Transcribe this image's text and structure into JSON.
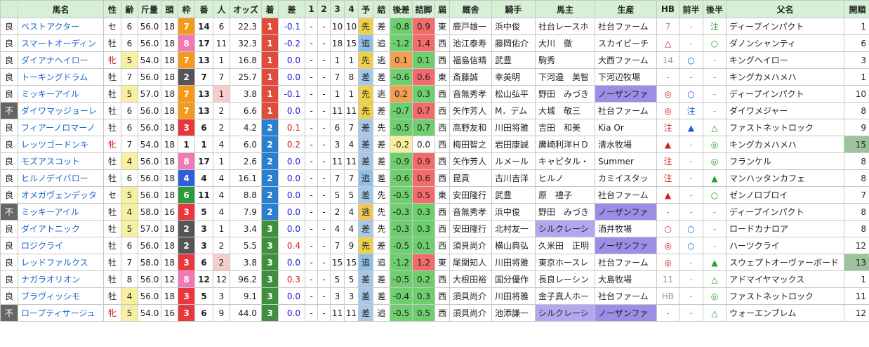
{
  "columns": [
    "馬名",
    "性",
    "齢",
    "斤量",
    "頭",
    "枠",
    "番",
    "人",
    "オッズ",
    "着",
    "差",
    "1",
    "2",
    "3",
    "4",
    "予",
    "結",
    "後差",
    "詰脚",
    "屆",
    "厩舎",
    "騎手",
    "馬主",
    "生産",
    "HB",
    "前半",
    "後半",
    "父名",
    "開順"
  ],
  "colors": {
    "header": "#d6f0d6",
    "frame": {
      "1": "#ffffff",
      "2": "#555555",
      "3": "#e8383d",
      "4": "#2d5fd8",
      "5": "#f2df30",
      "6": "#2a9a3c",
      "7": "#f39a1c",
      "8": "#f07ab4"
    },
    "finish": {
      "1": "#e24a3a",
      "2": "#2a7fd0",
      "3": "#3f8f3f"
    },
    "yoso": {
      "先": "#ecd24a",
      "追": "#8fbfe6",
      "差": "#a8c8e8",
      "逃": "#ecc85a"
    },
    "kekka": {
      "逃": "#ffffff",
      "先": "#ffffff",
      "差": "#ffffff",
      "追": "#ffffff"
    },
    "owner_special": "#b5a6f0",
    "breeder_special": "#9a8ee6"
  },
  "rows": [
    {
      "cond": "良",
      "name": "ベストアクター",
      "sex": "セ",
      "age": "6",
      "weight": "56.0",
      "heads": "18",
      "frame": "7",
      "num": "14",
      "pop": "6",
      "pop_hl": "",
      "odds": "22.3",
      "finish": "1",
      "margin": "-0.1",
      "c1": "-",
      "c2": "-",
      "c3": "10",
      "c4": "10",
      "yoso": "先",
      "kekka": "差",
      "late": "-0.8",
      "late_bg": "#6ecf6e",
      "tsume": "0.9",
      "tsume_bg": "#f36b6b",
      "area": "東",
      "trainer": "鹿戸雄一",
      "jockey": "浜中俊",
      "owner": "社台レースホ",
      "owner_hl": false,
      "breeder": "社台ファーム",
      "breeder_hl": false,
      "hb": "7",
      "hb_color": "#999999",
      "front": "-",
      "front_color": "#999999",
      "back": "注",
      "back_color": "#2aa02a",
      "sire": "ディープインパクト",
      "open": "1",
      "open_bg": ""
    },
    {
      "cond": "良",
      "name": "スマートオーディン",
      "sex": "牡",
      "age": "6",
      "weight": "56.0",
      "heads": "18",
      "frame": "8",
      "num": "17",
      "pop": "11",
      "pop_hl": "",
      "odds": "32.3",
      "finish": "1",
      "margin": "-0.2",
      "c1": "-",
      "c2": "-",
      "c3": "18",
      "c4": "15",
      "yoso": "追",
      "kekka": "追",
      "late": "-1.2",
      "late_bg": "#6ecf6e",
      "tsume": "1.4",
      "tsume_bg": "#f36b6b",
      "area": "西",
      "trainer": "池江泰寿",
      "jockey": "藤岡佑介",
      "owner": "大川　徹",
      "owner_hl": false,
      "breeder": "スカイビーチ",
      "breeder_hl": false,
      "hb": "△",
      "hb_color": "#cc2222",
      "front": "-",
      "front_color": "#999999",
      "back": "○",
      "back_color": "#2aa02a",
      "sire": "ダノンシャンティ",
      "open": "6",
      "open_bg": ""
    },
    {
      "cond": "良",
      "name": "ダイアナヘイロー",
      "sex": "牝",
      "age": "5",
      "weight": "54.0",
      "heads": "18",
      "frame": "7",
      "num": "13",
      "pop": "1",
      "pop_hl": "",
      "odds": "16.8",
      "finish": "1",
      "margin": "0.0",
      "c1": "-",
      "c2": "-",
      "c3": "1",
      "c4": "1",
      "yoso": "先",
      "kekka": "逃",
      "late": "0.1",
      "late_bg": "#f0a050",
      "tsume": "0.1",
      "tsume_bg": "#6ecf6e",
      "area": "西",
      "trainer": "福島信晴",
      "jockey": "武豊",
      "owner": "駒秀",
      "owner_hl": false,
      "breeder": "大西ファーム",
      "breeder_hl": false,
      "hb": "14",
      "hb_color": "#999999",
      "front": "○",
      "front_color": "#1a5fd0",
      "back": "-",
      "back_color": "#999999",
      "sire": "キングヘイロー",
      "open": "3",
      "open_bg": ""
    },
    {
      "cond": "良",
      "name": "トーキングドラム",
      "sex": "牡",
      "age": "7",
      "weight": "56.0",
      "heads": "18",
      "frame": "2",
      "num": "7",
      "pop": "7",
      "pop_hl": "",
      "odds": "25.7",
      "finish": "1",
      "margin": "0.0",
      "c1": "-",
      "c2": "-",
      "c3": "7",
      "c4": "8",
      "yoso": "差",
      "kekka": "差",
      "late": "-0.6",
      "late_bg": "#6ecf6e",
      "tsume": "0.6",
      "tsume_bg": "#f36b6b",
      "area": "東",
      "trainer": "斎藤誠",
      "jockey": "幸英明",
      "owner": "下河邉　美智",
      "owner_hl": false,
      "breeder": "下河辺牧場",
      "breeder_hl": false,
      "hb": "-",
      "hb_color": "#999999",
      "front": "-",
      "front_color": "#999999",
      "back": "-",
      "back_color": "#999999",
      "sire": "キングカメハメハ",
      "open": "1",
      "open_bg": ""
    },
    {
      "cond": "良",
      "name": "ミッキーアイル",
      "sex": "牡",
      "age": "5",
      "weight": "57.0",
      "heads": "18",
      "frame": "7",
      "num": "13",
      "pop": "1",
      "pop_hl": "#f6cccc",
      "odds": "3.8",
      "finish": "1",
      "margin": "-0.1",
      "c1": "-",
      "c2": "-",
      "c3": "1",
      "c4": "1",
      "yoso": "先",
      "kekka": "逃",
      "late": "0.2",
      "late_bg": "#f0a050",
      "tsume": "0.3",
      "tsume_bg": "#6ecf6e",
      "area": "西",
      "trainer": "音無秀孝",
      "jockey": "松山弘平",
      "owner": "野田　みづき",
      "owner_hl": false,
      "breeder": "ノーザンファ",
      "breeder_hl": true,
      "hb": "◎",
      "hb_color": "#cc2222",
      "front": "○",
      "front_color": "#1a5fd0",
      "back": "-",
      "back_color": "#999999",
      "sire": "ディープインパクト",
      "open": "10",
      "open_bg": ""
    },
    {
      "cond": "不",
      "name": "ダイワマッジョーレ",
      "sex": "牡",
      "age": "6",
      "weight": "56.0",
      "heads": "18",
      "frame": "7",
      "num": "13",
      "pop": "2",
      "pop_hl": "",
      "odds": "6.6",
      "finish": "1",
      "margin": "0.0",
      "c1": "-",
      "c2": "-",
      "c3": "11",
      "c4": "11",
      "yoso": "先",
      "kekka": "差",
      "late": "-0.7",
      "late_bg": "#6ecf6e",
      "tsume": "0.7",
      "tsume_bg": "#f36b6b",
      "area": "西",
      "trainer": "矢作芳人",
      "jockey": "M．デム",
      "owner": "大城　敬三",
      "owner_hl": false,
      "breeder": "社台ファーム",
      "breeder_hl": false,
      "hb": "◎",
      "hb_color": "#cc2222",
      "front": "注",
      "front_color": "#1a5fd0",
      "back": "-",
      "back_color": "#999999",
      "sire": "ダイワメジャー",
      "open": "8",
      "open_bg": ""
    },
    {
      "cond": "良",
      "name": "フィアーノロマーノ",
      "sex": "牡",
      "age": "6",
      "weight": "56.0",
      "heads": "18",
      "frame": "3",
      "num": "6",
      "pop": "2",
      "pop_hl": "",
      "odds": "4.2",
      "finish": "2",
      "margin": "0.1",
      "c1": "-",
      "c2": "-",
      "c3": "6",
      "c4": "7",
      "yoso": "差",
      "kekka": "先",
      "late": "-0.5",
      "late_bg": "#6ecf6e",
      "tsume": "0.7",
      "tsume_bg": "#6ecf6e",
      "area": "西",
      "trainer": "高野友和",
      "jockey": "川田将雅",
      "owner": "吉田　和美",
      "owner_hl": false,
      "breeder": "Kia Or",
      "breeder_hl": false,
      "hb": "注",
      "hb_color": "#cc2222",
      "front": "▲",
      "front_color": "#1a5fd0",
      "back": "△",
      "back_color": "#2aa02a",
      "sire": "ファストネットロック",
      "open": "9",
      "open_bg": ""
    },
    {
      "cond": "良",
      "name": "レッツゴードンキ",
      "sex": "牝",
      "age": "7",
      "weight": "54.0",
      "heads": "18",
      "frame": "1",
      "num": "1",
      "pop": "4",
      "pop_hl": "",
      "odds": "6.0",
      "finish": "2",
      "margin": "0.2",
      "c1": "-",
      "c2": "-",
      "c3": "3",
      "c4": "4",
      "yoso": "差",
      "kekka": "差",
      "late": "-0.2",
      "late_bg": "#f7f0a0",
      "tsume": "0.0",
      "tsume_bg": "#ffffff",
      "area": "西",
      "trainer": "梅田智之",
      "jockey": "岩田康誠",
      "owner": "廣崎利洋ＨＤ",
      "owner_hl": false,
      "breeder": "清水牧場",
      "breeder_hl": false,
      "hb": "▲",
      "hb_color": "#cc2222",
      "front": "-",
      "front_color": "#999999",
      "back": "◎",
      "back_color": "#2aa02a",
      "sire": "キングカメハメハ",
      "open": "15",
      "open_bg": "#9dc39d"
    },
    {
      "cond": "良",
      "name": "モズアスコット",
      "sex": "牡",
      "age": "4",
      "weight": "56.0",
      "heads": "18",
      "frame": "8",
      "num": "17",
      "pop": "1",
      "pop_hl": "",
      "odds": "2.6",
      "finish": "2",
      "margin": "0.0",
      "c1": "-",
      "c2": "-",
      "c3": "11",
      "c4": "11",
      "yoso": "差",
      "kekka": "差",
      "late": "-0.9",
      "late_bg": "#6ecf6e",
      "tsume": "0.9",
      "tsume_bg": "#f36b6b",
      "area": "西",
      "trainer": "矢作芳人",
      "jockey": "ルメール",
      "owner": "キャピタル・",
      "owner_hl": false,
      "breeder": "Summer",
      "breeder_hl": false,
      "hb": "注",
      "hb_color": "#cc2222",
      "front": "-",
      "front_color": "#999999",
      "back": "◎",
      "back_color": "#2aa02a",
      "sire": "フランケル",
      "open": "8",
      "open_bg": ""
    },
    {
      "cond": "良",
      "name": "ヒルノデイバロー",
      "sex": "牡",
      "age": "6",
      "weight": "56.0",
      "heads": "18",
      "frame": "4",
      "num": "4",
      "pop": "4",
      "pop_hl": "",
      "odds": "16.1",
      "finish": "2",
      "margin": "0.0",
      "c1": "-",
      "c2": "-",
      "c3": "7",
      "c4": "7",
      "yoso": "追",
      "kekka": "差",
      "late": "-0.6",
      "late_bg": "#6ecf6e",
      "tsume": "0.6",
      "tsume_bg": "#f36b6b",
      "area": "西",
      "trainer": "昆貢",
      "jockey": "古川吉洋",
      "owner": "ヒルノ",
      "owner_hl": false,
      "breeder": "カミイスタッ",
      "breeder_hl": false,
      "hb": "注",
      "hb_color": "#cc2222",
      "front": "-",
      "front_color": "#999999",
      "back": "▲",
      "back_color": "#2aa02a",
      "sire": "マンハッタンカフェ",
      "open": "8",
      "open_bg": ""
    },
    {
      "cond": "良",
      "name": "オメガヴェンデッタ",
      "sex": "セ",
      "age": "5",
      "weight": "56.0",
      "heads": "18",
      "frame": "6",
      "num": "11",
      "pop": "4",
      "pop_hl": "",
      "odds": "8.8",
      "finish": "2",
      "margin": "0.0",
      "c1": "-",
      "c2": "-",
      "c3": "5",
      "c4": "5",
      "yoso": "差",
      "kekka": "先",
      "late": "-0.5",
      "late_bg": "#6ecf6e",
      "tsume": "0.5",
      "tsume_bg": "#f36b6b",
      "area": "東",
      "trainer": "安田隆行",
      "jockey": "武豊",
      "owner": "原　禮子",
      "owner_hl": false,
      "breeder": "社台ファーム",
      "breeder_hl": false,
      "hb": "▲",
      "hb_color": "#cc2222",
      "front": "-",
      "front_color": "#999999",
      "back": "○",
      "back_color": "#2aa02a",
      "sire": "ゼンノロブロイ",
      "open": "7",
      "open_bg": ""
    },
    {
      "cond": "不",
      "name": "ミッキーアイル",
      "sex": "牡",
      "age": "4",
      "weight": "58.0",
      "heads": "16",
      "frame": "3",
      "num": "5",
      "pop": "4",
      "pop_hl": "",
      "odds": "7.9",
      "finish": "2",
      "margin": "0.0",
      "c1": "-",
      "c2": "-",
      "c3": "2",
      "c4": "4",
      "yoso": "逃",
      "kekka": "先",
      "late": "-0.3",
      "late_bg": "#6ecf6e",
      "tsume": "0.3",
      "tsume_bg": "#6ecf6e",
      "area": "西",
      "trainer": "音無秀孝",
      "jockey": "浜中俊",
      "owner": "野田　みづき",
      "owner_hl": false,
      "breeder": "ノーザンファ",
      "breeder_hl": true,
      "hb": "-",
      "hb_color": "#999999",
      "front": "-",
      "front_color": "#999999",
      "back": "-",
      "back_color": "#999999",
      "sire": "ディープインパクト",
      "open": "8",
      "open_bg": ""
    },
    {
      "cond": "良",
      "name": "ダイアトニック",
      "sex": "牡",
      "age": "5",
      "weight": "57.0",
      "heads": "18",
      "frame": "2",
      "num": "3",
      "pop": "1",
      "pop_hl": "",
      "odds": "3.4",
      "finish": "3",
      "margin": "0.0",
      "c1": "-",
      "c2": "-",
      "c3": "4",
      "c4": "4",
      "yoso": "差",
      "kekka": "先",
      "late": "-0.3",
      "late_bg": "#6ecf6e",
      "tsume": "0.3",
      "tsume_bg": "#6ecf6e",
      "area": "西",
      "trainer": "安田隆行",
      "jockey": "北村友一",
      "owner": "シルクレーシ",
      "owner_hl": true,
      "breeder": "酒井牧場",
      "breeder_hl": false,
      "hb": "○",
      "hb_color": "#cc2222",
      "front": "○",
      "front_color": "#1a5fd0",
      "back": "-",
      "back_color": "#999999",
      "sire": "ロードカナロア",
      "open": "8",
      "open_bg": ""
    },
    {
      "cond": "良",
      "name": "ロジクライ",
      "sex": "牡",
      "age": "6",
      "weight": "56.0",
      "heads": "18",
      "frame": "2",
      "num": "3",
      "pop": "2",
      "pop_hl": "",
      "odds": "5.5",
      "finish": "3",
      "margin": "0.4",
      "c1": "-",
      "c2": "-",
      "c3": "7",
      "c4": "9",
      "yoso": "先",
      "kekka": "差",
      "late": "-0.5",
      "late_bg": "#6ecf6e",
      "tsume": "0.1",
      "tsume_bg": "#6ecf6e",
      "area": "西",
      "trainer": "須貝尚介",
      "jockey": "横山典弘",
      "owner": "久米田　正明",
      "owner_hl": false,
      "breeder": "ノーザンファ",
      "breeder_hl": true,
      "hb": "◎",
      "hb_color": "#cc2222",
      "front": "○",
      "front_color": "#1a5fd0",
      "back": "-",
      "back_color": "#999999",
      "sire": "ハーツクライ",
      "open": "12",
      "open_bg": ""
    },
    {
      "cond": "良",
      "name": "レッドファルクス",
      "sex": "牡",
      "age": "7",
      "weight": "58.0",
      "heads": "18",
      "frame": "3",
      "num": "6",
      "pop": "2",
      "pop_hl": "#f6cccc",
      "odds": "3.8",
      "finish": "3",
      "margin": "0.0",
      "c1": "-",
      "c2": "-",
      "c3": "15",
      "c4": "15",
      "yoso": "追",
      "kekka": "追",
      "late": "-1.2",
      "late_bg": "#6ecf6e",
      "tsume": "1.2",
      "tsume_bg": "#f36b6b",
      "area": "東",
      "trainer": "尾関知人",
      "jockey": "川田将雅",
      "owner": "東京ホースレ",
      "owner_hl": false,
      "breeder": "社台ファーム",
      "breeder_hl": false,
      "hb": "◎",
      "hb_color": "#cc2222",
      "front": "-",
      "front_color": "#999999",
      "back": "▲",
      "back_color": "#2aa02a",
      "sire": "スウェプトオーヴァーボード",
      "open": "13",
      "open_bg": "#9dc39d"
    },
    {
      "cond": "良",
      "name": "ナガラオリオン",
      "sex": "牡",
      "age": "8",
      "weight": "56.0",
      "heads": "12",
      "frame": "8",
      "num": "12",
      "pop": "12",
      "pop_hl": "",
      "odds": "96.2",
      "finish": "3",
      "margin": "0.3",
      "c1": "-",
      "c2": "-",
      "c3": "5",
      "c4": "5",
      "yoso": "差",
      "kekka": "差",
      "late": "-0.5",
      "late_bg": "#6ecf6e",
      "tsume": "0.2",
      "tsume_bg": "#6ecf6e",
      "area": "西",
      "trainer": "大根田裕",
      "jockey": "国分優作",
      "owner": "長良レーシン",
      "owner_hl": false,
      "breeder": "大島牧場",
      "breeder_hl": false,
      "hb": "11",
      "hb_color": "#999999",
      "front": "-",
      "front_color": "#999999",
      "back": "△",
      "back_color": "#2aa02a",
      "sire": "アドマイヤマックス",
      "open": "1",
      "open_bg": ""
    },
    {
      "cond": "良",
      "name": "ブラヴィッシモ",
      "sex": "牡",
      "age": "4",
      "weight": "56.0",
      "heads": "18",
      "frame": "3",
      "num": "5",
      "pop": "3",
      "pop_hl": "",
      "odds": "9.1",
      "finish": "3",
      "margin": "0.0",
      "c1": "-",
      "c2": "-",
      "c3": "3",
      "c4": "3",
      "yoso": "差",
      "kekka": "差",
      "late": "-0.4",
      "late_bg": "#6ecf6e",
      "tsume": "0.3",
      "tsume_bg": "#6ecf6e",
      "area": "西",
      "trainer": "須貝尚介",
      "jockey": "川田将雅",
      "owner": "金子真人ホー",
      "owner_hl": false,
      "breeder": "社台ファーム",
      "breeder_hl": false,
      "hb": "HB",
      "hb_color": "#999999",
      "front": "-",
      "front_color": "#999999",
      "back": "◎",
      "back_color": "#2aa02a",
      "sire": "ファストネットロック",
      "open": "11",
      "open_bg": ""
    },
    {
      "cond": "不",
      "name": "ロープティサージュ",
      "sex": "牝",
      "age": "5",
      "weight": "54.0",
      "heads": "16",
      "frame": "3",
      "num": "6",
      "pop": "9",
      "pop_hl": "",
      "odds": "44.0",
      "finish": "3",
      "margin": "0.0",
      "c1": "-",
      "c2": "-",
      "c3": "11",
      "c4": "11",
      "yoso": "差",
      "kekka": "追",
      "late": "-0.5",
      "late_bg": "#6ecf6e",
      "tsume": "0.5",
      "tsume_bg": "#6ecf6e",
      "area": "西",
      "trainer": "須貝尚介",
      "jockey": "池添謙一",
      "owner": "シルクレーシ",
      "owner_hl": true,
      "breeder": "ノーザンファ",
      "breeder_hl": true,
      "hb": "-",
      "hb_color": "#999999",
      "front": "-",
      "front_color": "#999999",
      "back": "△",
      "back_color": "#2aa02a",
      "sire": "ウォーエンブレム",
      "open": "12",
      "open_bg": ""
    }
  ]
}
